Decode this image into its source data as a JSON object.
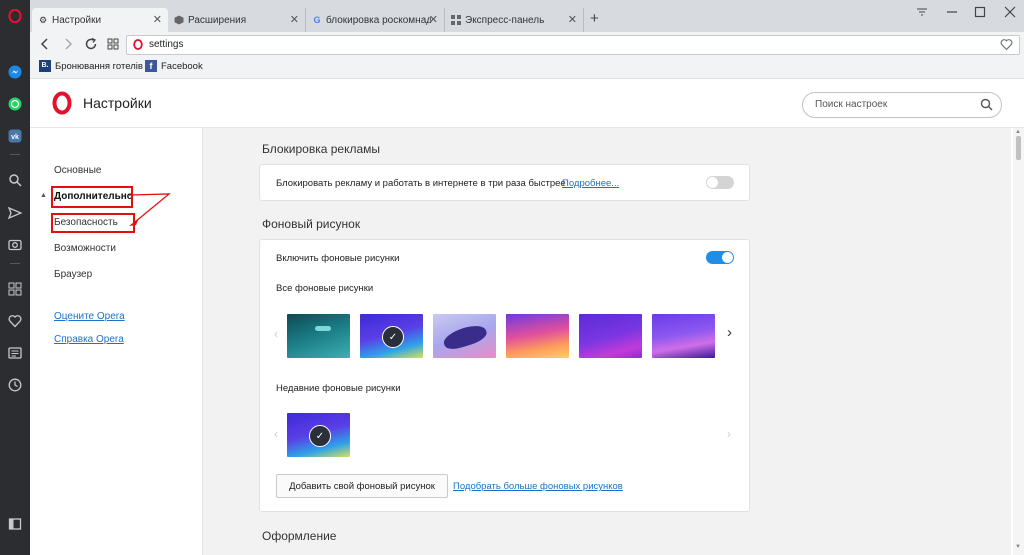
{
  "tabs": [
    {
      "label": "Настройки",
      "icon": "gear-icon",
      "active": true
    },
    {
      "label": "Расширения",
      "icon": "cube-icon",
      "active": false
    },
    {
      "label": "блокировка роскомнадз",
      "icon": "google-icon",
      "active": false
    },
    {
      "label": "Экспресс-панель",
      "icon": "grid-icon",
      "active": false
    }
  ],
  "address": {
    "url": "settings"
  },
  "bookmarks": [
    {
      "label": "Бронювання готелів",
      "icon_text": "B."
    },
    {
      "label": "Facebook",
      "icon_text": "f"
    }
  ],
  "header": {
    "title": "Настройки",
    "search_placeholder": "Поиск настроек"
  },
  "nav": {
    "basic": "Основные",
    "advanced": "Дополнительно",
    "security": "Безопасность",
    "features": "Возможности",
    "browser": "Браузер",
    "rate": "Оцените Opera",
    "help": "Справка Opera"
  },
  "adblock": {
    "title": "Блокировка рекламы",
    "text": "Блокировать рекламу и работать в интернете в три раза быстрее",
    "more_link": "Подробнее...",
    "enabled": false
  },
  "wallpaper": {
    "title": "Фоновый рисунок",
    "enable_label": "Включить фоновые рисунки",
    "enabled": true,
    "all_label": "Все фоновые рисунки",
    "recent_label": "Недавние фоновые рисунки",
    "add_button": "Добавить свой фоновый рисунок",
    "more_link": "Подобрать больше фоновых рисунков"
  },
  "appearance": {
    "title": "Оформление"
  },
  "colors": {
    "accent": "#1f8ee8",
    "opera_red": "#e3112c",
    "link": "#1a73c8",
    "annotation": "#e31010"
  }
}
